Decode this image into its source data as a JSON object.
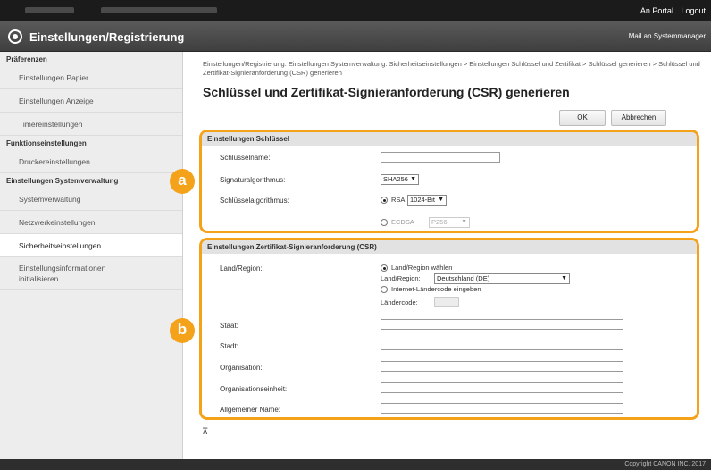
{
  "topbar": {
    "portal_link": "An Portal",
    "logout_link": "Logout"
  },
  "appbar": {
    "title": "Einstellungen/Registrierung",
    "mail_link": "Mail an Systemmanager"
  },
  "sidebar": {
    "section1": "Präferenzen",
    "item_paper": "Einstellungen Papier",
    "item_display": "Einstellungen Anzeige",
    "item_timer": "Timereinstellungen",
    "section2": "Funktionseinstellungen",
    "item_printer": "Druckereinstellungen",
    "section3": "Einstellungen Systemverwaltung",
    "item_sysadmin": "Systemverwaltung",
    "item_network": "Netzwerkeinstellungen",
    "item_security": "Sicherheitseinstellungen",
    "item_init_1": "Einstellungsinformationen",
    "item_init_2": "initialisieren"
  },
  "main": {
    "breadcrumb": "Einstellungen/Registrierung: Einstellungen Systemverwaltung: Sicherheitseinstellungen > Einstellungen Schlüssel und Zertifikat > Schlüssel generieren > Schlüssel und Zertifikat-Signieranforderung (CSR) generieren",
    "page_title": "Schlüssel und Zertifikat-Signieranforderung (CSR) generieren",
    "ok_button": "OK",
    "cancel_button": "Abbrechen"
  },
  "key_section": {
    "header": "Einstellungen Schlüssel",
    "key_name_label": "Schlüsselname:",
    "key_name_value": "",
    "sig_algo_label": "Signaturalgorithmus:",
    "sig_algo_value": "SHA256",
    "key_algo_label": "Schlüsselalgorithmus:",
    "rsa_label": "RSA",
    "rsa_bits": "1024-Bit",
    "ecdsa_label": "ECDSA",
    "ecdsa_curve": "P256",
    "selected_key_algo": "RSA"
  },
  "csr_section": {
    "header": "Einstellungen Zertifikat-Signieranforderung (CSR)",
    "country_label": "Land/Region:",
    "opt_select_country": "Land/Region wählen",
    "country_select_label": "Land/Region:",
    "country_value": "Deutschland (DE)",
    "opt_enter_code": "Internet-Ländercode eingeben",
    "country_code_label": "Ländercode:",
    "country_code_value": "",
    "state_label": "Staat:",
    "city_label": "Stadt:",
    "org_label": "Organisation:",
    "org_unit_label": "Organisationseinheit:",
    "common_name_label": "Allgemeiner Name:",
    "state_value": "",
    "city_value": "",
    "org_value": "",
    "org_unit_value": "",
    "common_name_value": ""
  },
  "badges": {
    "a": "a",
    "b": "b"
  },
  "colors": {
    "accent": "#f5a21b",
    "topbar": "#1b1b1b",
    "appbar": "#4a4a4a"
  },
  "icons": {
    "logo": "settings-gear-icon",
    "to_top": "to-top-icon"
  },
  "to_top": "⊼",
  "footer": {
    "copyright": "Copyright CANON INC. 2017"
  }
}
